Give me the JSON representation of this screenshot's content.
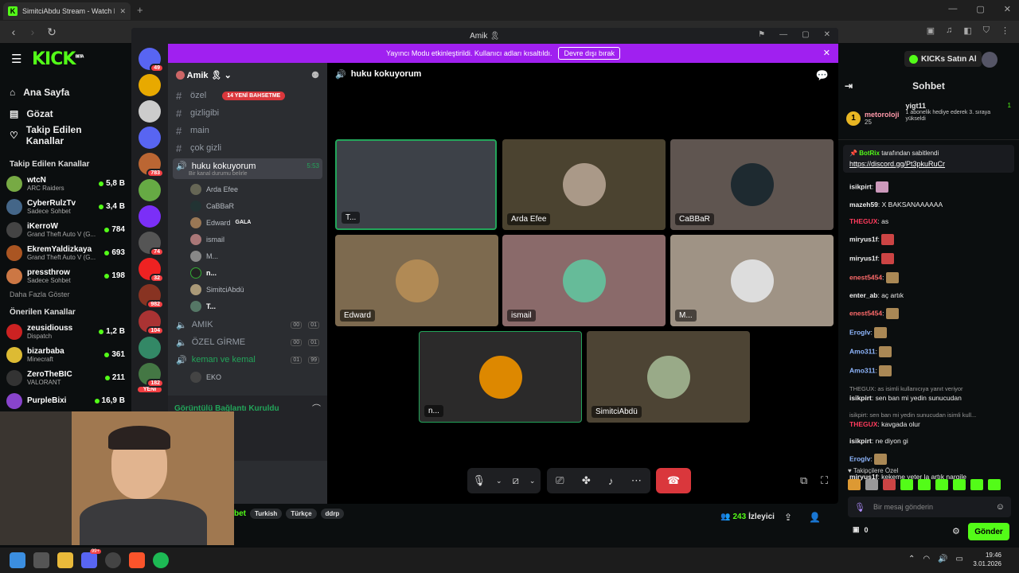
{
  "browser": {
    "tab_title": "SimitciAbdu Stream - Watch Liv",
    "new_tab": "+"
  },
  "kick": {
    "logo": "KICK",
    "logo_badge": "BETA",
    "nav": [
      "Ana Sayfa",
      "Gözat",
      "Takip Edilen Kanallar"
    ],
    "followed_title": "Takip Edilen Kanallar",
    "followed": [
      {
        "name": "wtcN",
        "sub": "ARC Raiders",
        "viewers": "5,8 B"
      },
      {
        "name": "CyberRulzTv",
        "sub": "Sadece Sohbet",
        "viewers": "3,4 B"
      },
      {
        "name": "iKerroW",
        "sub": "Grand Theft Auto V (G...",
        "viewers": "784"
      },
      {
        "name": "EkremYaldizkaya",
        "sub": "Grand Theft Auto V (G...",
        "viewers": "693"
      },
      {
        "name": "pressthrow",
        "sub": "Sadece Sohbet",
        "viewers": "198"
      }
    ],
    "show_more": "Daha Fazla Göster",
    "recommended_title": "Önerilen Kanallar",
    "recommended": [
      {
        "name": "zeusidiouss",
        "sub": "Dispatch",
        "viewers": "1,2 B"
      },
      {
        "name": "bizarbaba",
        "sub": "Minecraft",
        "viewers": "361"
      },
      {
        "name": "ZeroTheBIC",
        "sub": "VALORANT",
        "viewers": "211"
      },
      {
        "name": "PurpleBixi",
        "sub": "",
        "viewers": "16,9 B"
      }
    ],
    "buy_kicks": "KICKs Satın Al",
    "tags": [
      "Turkish",
      "Türkçe",
      "ddrp"
    ],
    "tag_prefix": "bet",
    "viewers": "243",
    "viewers_label": "İzleyici"
  },
  "discord": {
    "window_title": "Amik 🎗",
    "banner_text": "Yayıncı Modu etkinleştirildi. Kullanıcı adları kısaltıldı.",
    "banner_button": "Devre dışı bırak",
    "server_name": "Amik 🎗",
    "servers_badges": [
      "49",
      "783",
      "74",
      "32",
      "982",
      "104",
      "182"
    ],
    "new_label": "YENİ",
    "mention_pill": "14 YENİ BAHSETME",
    "text_channels": [
      "özel",
      "gizligibi",
      "main",
      "çok gizli"
    ],
    "active_voice": {
      "name": "huku kokuyorum",
      "time": "5:53",
      "status": "Bir kanal durumu belirle"
    },
    "voice_users": [
      "Arda Efee",
      "CaBBaR",
      "Edward",
      "ismail",
      "M...",
      "n...",
      "SimitciAbdü",
      "T..."
    ],
    "edward_tag": "GALA",
    "other_voice": [
      {
        "name": "AMIK",
        "a": "00",
        "b": "01"
      },
      {
        "name": "ÖZEL GİRME",
        "a": "00",
        "b": "01"
      },
      {
        "name": "keman ve kemal",
        "a": "01",
        "b": "99"
      }
    ],
    "eko_user": "EKO",
    "connection": "Görüntülü Bağlantı Kuruldu",
    "stage_title": "huku kokuyorum",
    "tiles": [
      "T...",
      "Arda Efee",
      "CaBBaR",
      "Edward",
      "ismail",
      "M...",
      "n...",
      "SimitciAbdü"
    ]
  },
  "chat": {
    "title": "Sohbet",
    "pinned_user": "metoroloji",
    "pinned_count": "25",
    "gift_user": "yigt11",
    "gift_count": "1",
    "gift_text": "1 abonelik hediye ederek 3. sıraya yükseldi",
    "pin_by": "BotRix",
    "pin_by_suffix": "tarafından sabitlendi",
    "pin_link": "https://discord.gg/Pt3pkuRuCr",
    "messages": [
      {
        "user": "isikpirt",
        "text": "",
        "color": "#ffffff"
      },
      {
        "user": "mazeh59",
        "text": "X BAKSANAAAAAA",
        "color": "#ffffff"
      },
      {
        "user": "THEGUX",
        "text": "as",
        "color": "#ff3b5c"
      },
      {
        "user": "miryus1f",
        "text": "",
        "color": "#ffffff"
      },
      {
        "user": "miryus1f",
        "text": "",
        "color": "#ffffff"
      },
      {
        "user": "enest5454",
        "text": "",
        "color": "#ff6b6b"
      },
      {
        "user": "enter_ab",
        "text": "aç artık",
        "color": "#ffffff"
      },
      {
        "user": "enest5454",
        "text": "",
        "color": "#ff6b6b"
      },
      {
        "user": "Eroglv",
        "text": "",
        "color": "#8fb7ff"
      },
      {
        "user": "Amo311",
        "text": "",
        "color": "#8fb7ff"
      },
      {
        "user": "Amo311",
        "text": "",
        "color": "#8fb7ff"
      }
    ],
    "reply1": "THEGUX: as isimli kullanıcıya yanıt veriyor",
    "msg_r1": {
      "user": "isikpirt",
      "text": "sen ban mi yedin sunucudan"
    },
    "reply2": "isikpirt: sen ban mi yedin sunucudan isimli kull...",
    "msg_r2": {
      "user": "THEGUX",
      "text": "kavgada olur"
    },
    "msg_r3": {
      "user": "isikpirt",
      "text": "ne diyon gi"
    },
    "msg_r4": {
      "user": "Eroglv",
      "text": ""
    },
    "msg_r5": {
      "user": "miryus1f",
      "text": "kekeme yeter la artık nargile"
    },
    "followers_only": "Takipçilere Özel",
    "input_placeholder": "Bir mesaj gönderin",
    "points": "0",
    "send": "Gönder"
  },
  "taskbar": {
    "time": "19:46",
    "date": "3.01.2026",
    "discord_badge": "99+"
  },
  "colors": {
    "kick_green": "#53fc18",
    "discord_purple": "#a020f0",
    "discord_bg": "#1e1f22"
  }
}
